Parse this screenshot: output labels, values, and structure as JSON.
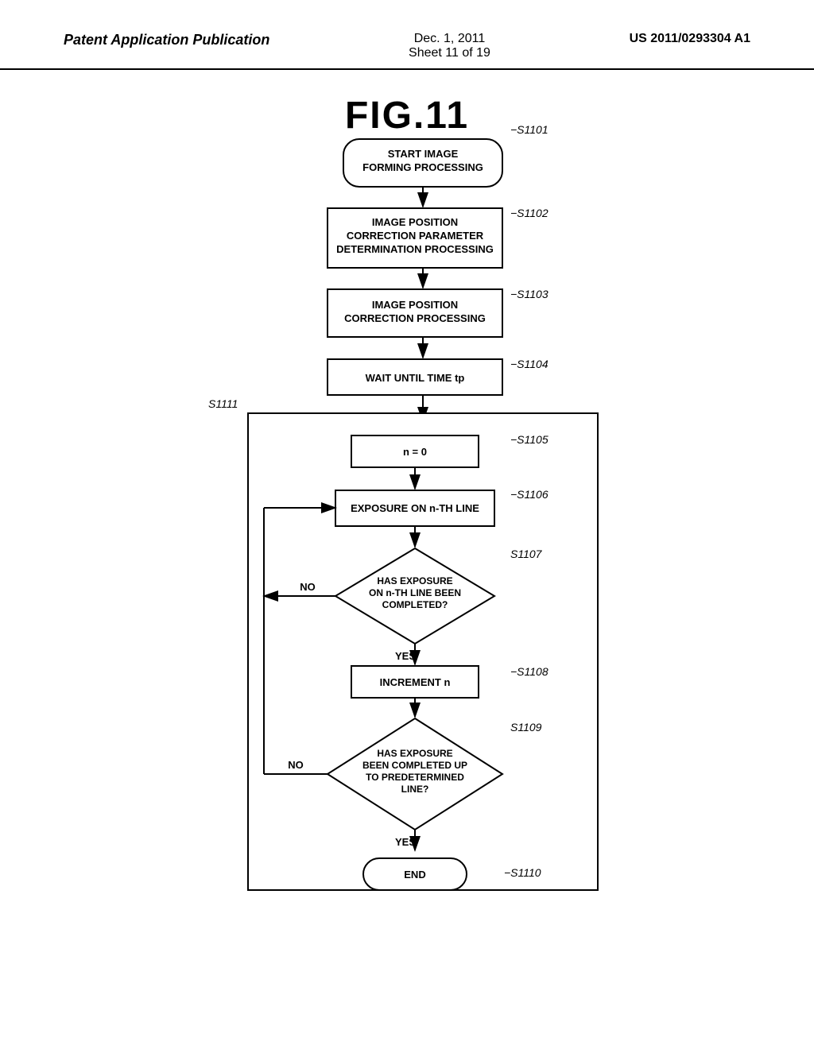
{
  "header": {
    "left": "Patent Application Publication",
    "center_date": "Dec. 1, 2011",
    "center_sheet": "Sheet 11 of 19",
    "right": "US 2011/0293304 A1"
  },
  "fig_title": "FIG.11",
  "nodes": {
    "s1101": {
      "label": "START IMAGE\nFORMING PROCESSING",
      "step": "S1101"
    },
    "s1102": {
      "label": "IMAGE POSITION\nCORRECTION PARAMETER\nDETERMINATION PROCESSING",
      "step": "S1102"
    },
    "s1103": {
      "label": "IMAGE POSITION\nCORRECTION PROCESSING",
      "step": "S1103"
    },
    "s1104": {
      "label": "WAIT UNTIL TIME tp",
      "step": "S1104"
    },
    "s1111": {
      "label": "S1111"
    },
    "s1105": {
      "label": "n = 0",
      "step": "S1105"
    },
    "s1106": {
      "label": "EXPOSURE ON n-TH LINE",
      "step": "S1106"
    },
    "s1107": {
      "label": "HAS EXPOSURE\nON n-TH LINE BEEN\nCOMPLETED?",
      "step": "S1107"
    },
    "s1108": {
      "label": "INCREMENT n",
      "step": "S1108"
    },
    "s1109": {
      "label": "HAS EXPOSURE\nBEEN COMPLETED UP\nTO PREDETERMINED\nLINE?",
      "step": "S1109"
    },
    "s1110": {
      "label": "END",
      "step": "S1110"
    }
  },
  "arrows": {
    "yes": "YES",
    "no": "NO"
  }
}
